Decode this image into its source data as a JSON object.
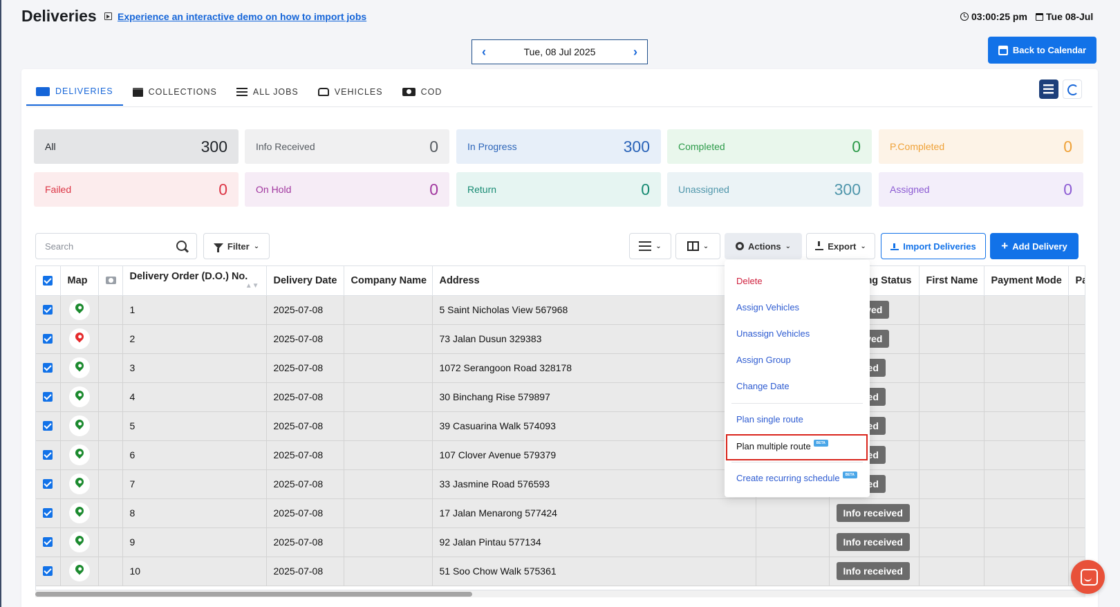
{
  "header": {
    "title": "Deliveries",
    "demo_link": "Experience an interactive demo on how to import jobs",
    "time": "03:00:25 pm",
    "date": "Tue 08-Jul"
  },
  "date_nav": {
    "prev": "‹",
    "next": "›",
    "date": "Tue, 08 Jul 2025"
  },
  "back_button": "Back to Calendar",
  "tabs": [
    {
      "label": "Deliveries",
      "icon": "truck-icon",
      "active": true
    },
    {
      "label": "Collections",
      "icon": "box-icon"
    },
    {
      "label": "All Jobs",
      "icon": "list-icon"
    },
    {
      "label": "Vehicles",
      "icon": "car-icon"
    },
    {
      "label": "COD",
      "icon": "cash-icon"
    }
  ],
  "status_tiles": [
    {
      "label": "All",
      "count": "300",
      "bg": "#e4e5e7",
      "color": "#1f2328"
    },
    {
      "label": "Info Received",
      "count": "0",
      "bg": "#f0f0f1",
      "color": "#555a60"
    },
    {
      "label": "In Progress",
      "count": "300",
      "bg": "#e7eff9",
      "color": "#2a63b8"
    },
    {
      "label": "Completed",
      "count": "0",
      "bg": "#e9f7ec",
      "color": "#2b9a48"
    },
    {
      "label": "P.Completed",
      "count": "0",
      "bg": "#fdf3e7",
      "color": "#efa137"
    },
    {
      "label": "Failed",
      "count": "0",
      "bg": "#fceced",
      "color": "#dc3545"
    },
    {
      "label": "On Hold",
      "count": "0",
      "bg": "#f6ecf6",
      "color": "#a0359e"
    },
    {
      "label": "Return",
      "count": "0",
      "bg": "#e6f5f2",
      "color": "#168a72"
    },
    {
      "label": "Unassigned",
      "count": "300",
      "bg": "#ebf3f6",
      "color": "#4f96ab"
    },
    {
      "label": "Assigned",
      "count": "0",
      "bg": "#f3eefa",
      "color": "#8c5bd3"
    }
  ],
  "toolbar": {
    "search_placeholder": "Search",
    "filter": "Filter",
    "actions": "Actions",
    "export": "Export",
    "import": "Import Deliveries",
    "add": "Add Delivery"
  },
  "table": {
    "columns": [
      "Map",
      "Delivery Order (D.O.) No.",
      "Delivery Date",
      "Company Name",
      "Address",
      "",
      "ng Status",
      "First Name",
      "Payment Mode",
      "Pa"
    ],
    "rows": [
      {
        "pin": "green",
        "no": "1",
        "date": "2025-07-08",
        "address": "5 Saint Nicholas View 567968",
        "status": "received"
      },
      {
        "pin": "red",
        "no": "2",
        "date": "2025-07-08",
        "address": "73 Jalan Dusun 329383",
        "status": "received"
      },
      {
        "pin": "green",
        "no": "3",
        "date": "2025-07-08",
        "address": "1072 Serangoon Road 328178",
        "status": "eceived"
      },
      {
        "pin": "green",
        "no": "4",
        "date": "2025-07-08",
        "address": "30 Binchang Rise 579897",
        "status": "eceived"
      },
      {
        "pin": "green",
        "no": "5",
        "date": "2025-07-08",
        "address": "39 Casuarina Walk 574093",
        "status": "eceived"
      },
      {
        "pin": "green",
        "no": "6",
        "date": "2025-07-08",
        "address": "107 Clover Avenue 579379",
        "status": "eceived"
      },
      {
        "pin": "green",
        "no": "7",
        "date": "2025-07-08",
        "address": "33 Jasmine Road 576593",
        "status": "eceived"
      },
      {
        "pin": "green",
        "no": "8",
        "date": "2025-07-08",
        "address": "17 Jalan Menarong 577424",
        "status": "Info received"
      },
      {
        "pin": "green",
        "no": "9",
        "date": "2025-07-08",
        "address": "92 Jalan Pintau 577134",
        "status": "Info received"
      },
      {
        "pin": "green",
        "no": "10",
        "date": "2025-07-08",
        "address": "51 Soo Chow Walk 575361",
        "status": "Info received"
      }
    ]
  },
  "actions_menu": {
    "items": [
      {
        "label": "Delete",
        "type": "danger"
      },
      {
        "label": "Assign Vehicles"
      },
      {
        "label": "Unassign Vehicles"
      },
      {
        "label": "Assign Group"
      },
      {
        "label": "Change Date"
      },
      {
        "label": "Plan single route"
      },
      {
        "label": "Plan multiple route",
        "beta": "BETA",
        "highlighted": true
      },
      {
        "label": "Create recurring schedule",
        "beta": "BETA"
      }
    ]
  }
}
